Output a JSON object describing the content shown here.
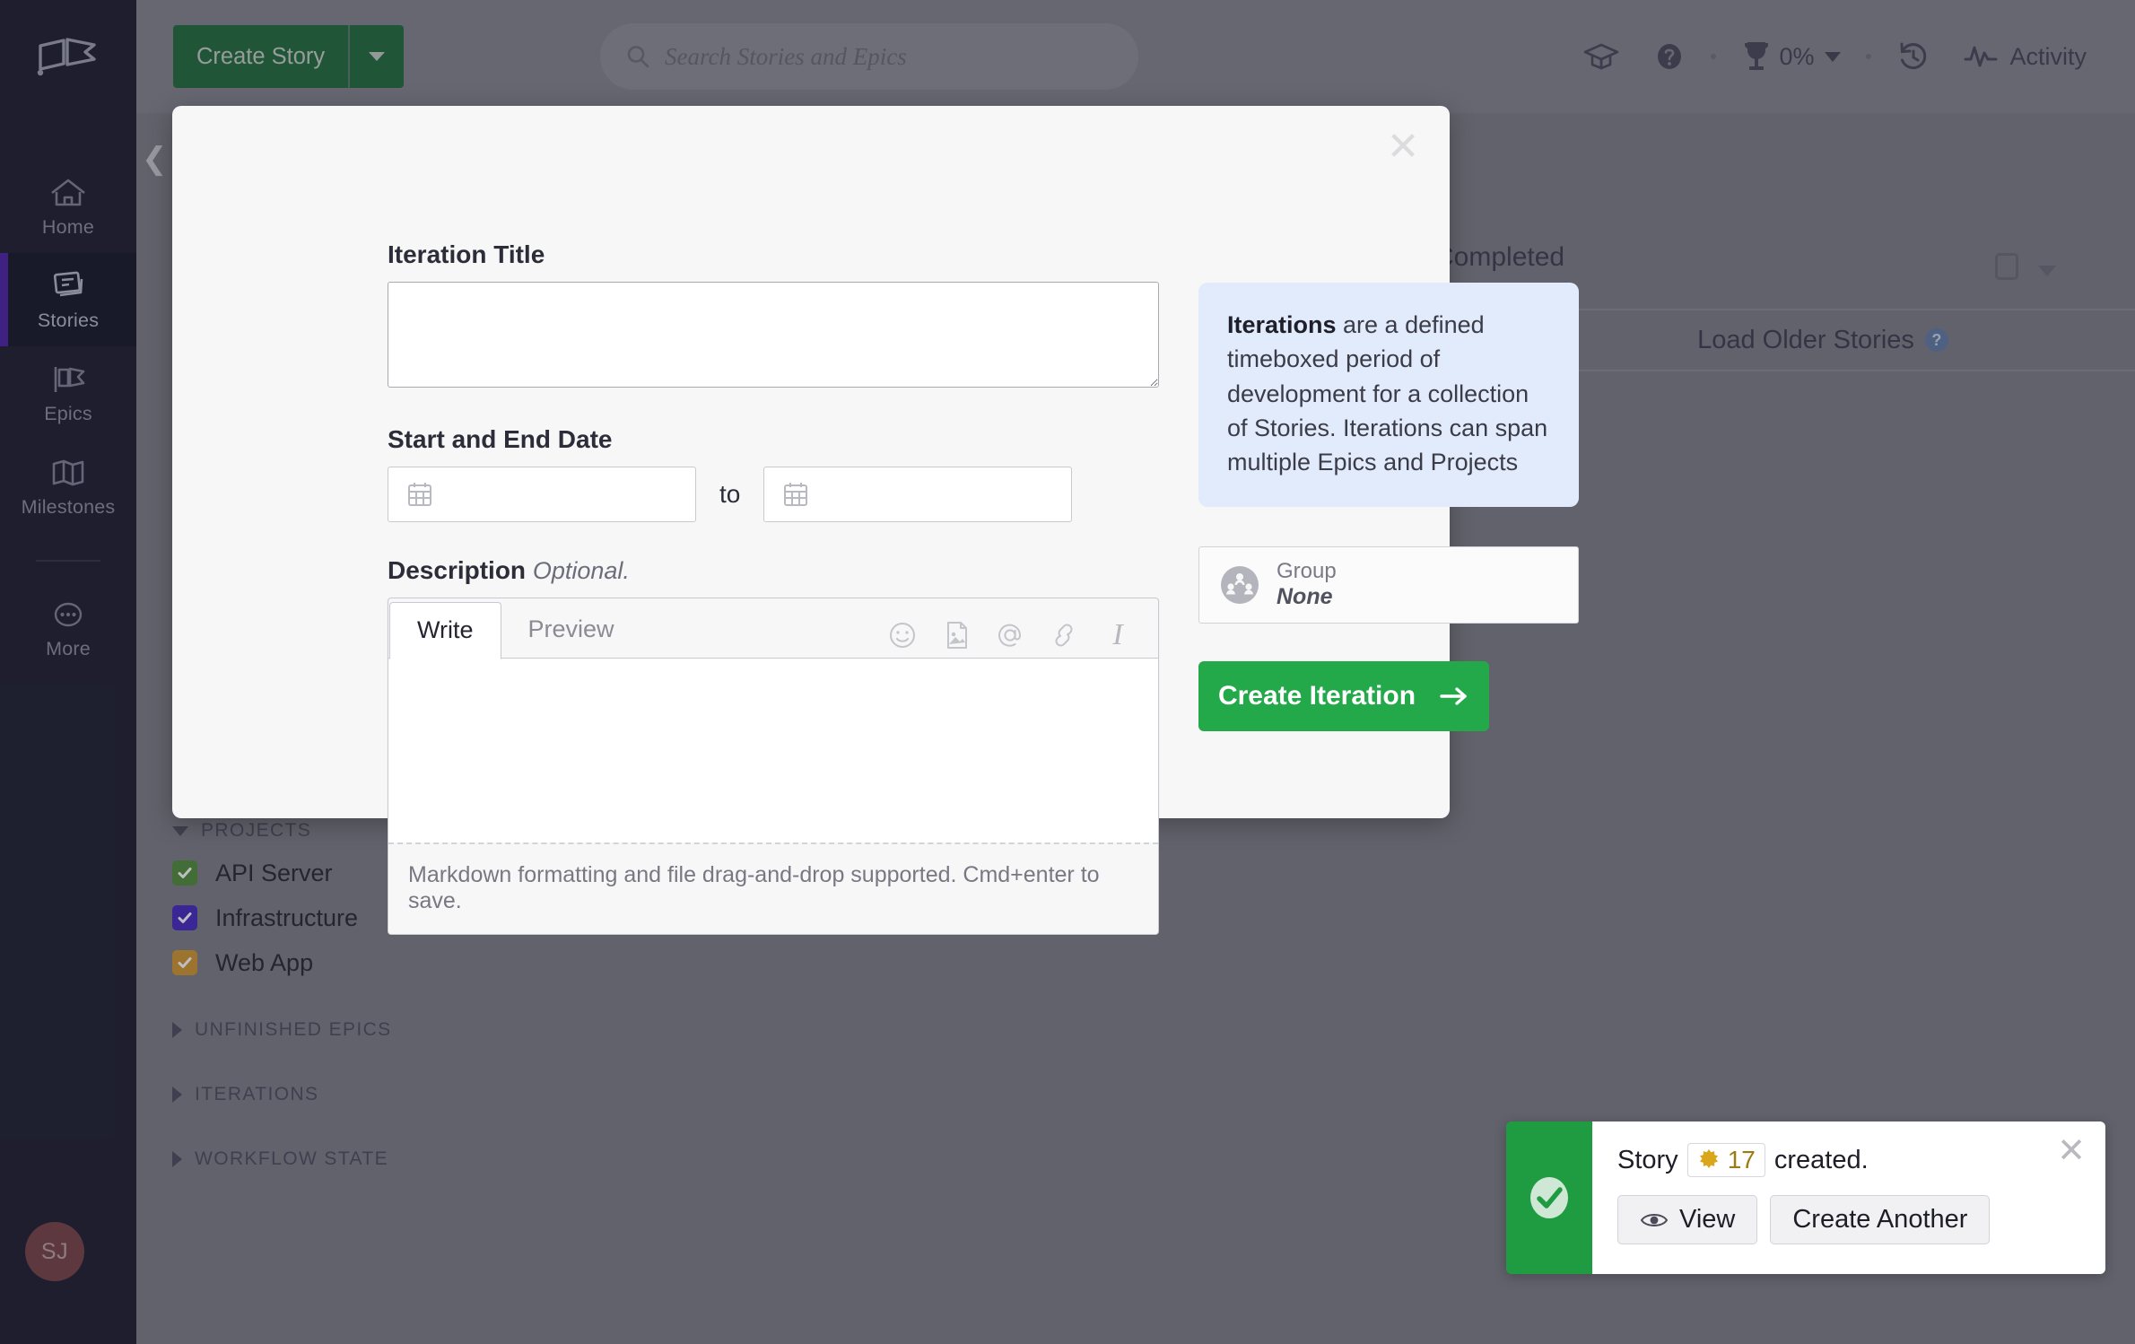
{
  "sidebar": {
    "logo_name": "clubhouse-logo",
    "items": [
      {
        "label": "Home",
        "icon": "home-icon",
        "active": false
      },
      {
        "label": "Stories",
        "icon": "stories-icon",
        "active": true
      },
      {
        "label": "Epics",
        "icon": "epics-flag-icon",
        "active": false
      },
      {
        "label": "Milestones",
        "icon": "milestones-map-icon",
        "active": false
      },
      {
        "label": "More",
        "icon": "more-ellipsis-icon",
        "active": false
      }
    ],
    "avatar_initials": "SJ"
  },
  "topbar": {
    "create_story_label": "Create Story",
    "create_story_caret": "chevron-down-icon",
    "search_placeholder": "Search Stories and Epics",
    "search_icon": "search-icon",
    "right_icons": [
      "graduation-cap-icon",
      "help-circle-icon",
      "trophy-icon",
      "history-clock-icon",
      "activity-pulse-icon"
    ],
    "progress_percent": "0%",
    "activity_label": "Activity"
  },
  "main": {
    "collapse_icon": "chevron-left-icon",
    "completed_label": "Completed",
    "load_older_label": "Load Older Stories",
    "load_older_help_icon": "help-circle-icon",
    "filters": [
      {
        "name": "PROJECTS",
        "expanded": true,
        "rows": [
          {
            "label": "API Server",
            "checked": true,
            "color": "#4e8b3a"
          },
          {
            "label": "Infrastructure",
            "checked": true,
            "color": "#4326bf"
          },
          {
            "label": "Web App",
            "checked": true,
            "color": "#cf9530"
          }
        ]
      },
      {
        "name": "UNFINISHED EPICS",
        "expanded": false,
        "rows": []
      },
      {
        "name": "ITERATIONS",
        "expanded": false,
        "rows": []
      },
      {
        "name": "WORKFLOW STATE",
        "expanded": false,
        "rows": []
      }
    ]
  },
  "modal": {
    "close_icon": "close-icon",
    "title_field": {
      "label": "Iteration Title",
      "value": "",
      "placeholder": ""
    },
    "date_field": {
      "label": "Start and End Date",
      "separator": "to",
      "start_value": "",
      "end_value": "",
      "calendar_icon": "calendar-icon"
    },
    "description": {
      "label": "Description",
      "optional_note": "Optional.",
      "tabs": [
        {
          "label": "Write",
          "active": true
        },
        {
          "label": "Preview",
          "active": false
        }
      ],
      "tools": [
        "emoji-smiley-icon",
        "image-attach-icon",
        "at-mention-icon",
        "link-icon",
        "italic-icon"
      ],
      "body_value": "",
      "footer_hint": "Markdown formatting and file drag-and-drop supported. Cmd+enter to save."
    },
    "info_box": {
      "lead": "Iterations",
      "text": " are a defined timeboxed period of development for a collection of Stories. Iterations can span multiple Epics and Projects"
    },
    "group_selector": {
      "icon": "group-people-icon",
      "label": "Group",
      "value": "None"
    },
    "submit": {
      "label": "Create Iteration",
      "icon": "arrow-right-icon",
      "color": "#23a94a"
    }
  },
  "toast": {
    "status_icon": "check-circle-icon",
    "text_before": "Story",
    "story_id": "17",
    "story_icon": "star-burst-icon",
    "text_after": "created.",
    "buttons": [
      {
        "label": "View",
        "icon": "eye-icon"
      },
      {
        "label": "Create Another",
        "icon": ""
      }
    ],
    "close_icon": "close-icon",
    "accent_color": "#1f9c42"
  }
}
